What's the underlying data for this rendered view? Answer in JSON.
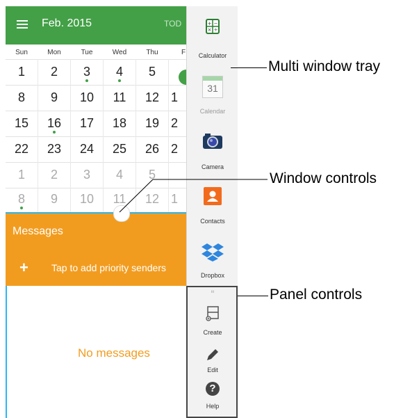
{
  "calendar": {
    "month": "Feb. 2015",
    "today_label": "TOD",
    "weekdays": [
      "Sun",
      "Mon",
      "Tue",
      "Wed",
      "Thu",
      "F"
    ],
    "rows": [
      [
        "1",
        "2",
        "3",
        "4",
        "5",
        ""
      ],
      [
        "8",
        "9",
        "10",
        "11",
        "12",
        "1"
      ],
      [
        "15",
        "16",
        "17",
        "18",
        "19",
        "2"
      ],
      [
        "22",
        "23",
        "24",
        "25",
        "26",
        "2"
      ],
      [
        "1",
        "2",
        "3",
        "4",
        "5",
        ""
      ],
      [
        "8",
        "9",
        "10",
        "11",
        "12",
        "1"
      ]
    ],
    "accent_color": "#43a047"
  },
  "messages": {
    "title": "Messages",
    "plus": "+",
    "add_priority": "Tap to add priority senders",
    "empty_text": "No messages",
    "accent_color": "#f29c1f"
  },
  "tray": {
    "apps": [
      {
        "label": "Calculator",
        "icon": "calculator-icon"
      },
      {
        "label": "Calendar",
        "icon": "calendar-icon",
        "icon_text": "31"
      },
      {
        "label": "Camera",
        "icon": "camera-icon"
      },
      {
        "label": "Contacts",
        "icon": "contacts-icon"
      },
      {
        "label": "Dropbox",
        "icon": "dropbox-icon"
      }
    ],
    "panel_controls": [
      {
        "label": "Create",
        "icon": "create-icon"
      },
      {
        "label": "Edit",
        "icon": "edit-pencil-icon"
      },
      {
        "label": "Help",
        "icon": "help-icon",
        "icon_text": "?"
      }
    ]
  },
  "callouts": {
    "multi_window_tray": "Multi window tray",
    "window_controls": "Window controls",
    "panel_controls": "Panel controls"
  }
}
